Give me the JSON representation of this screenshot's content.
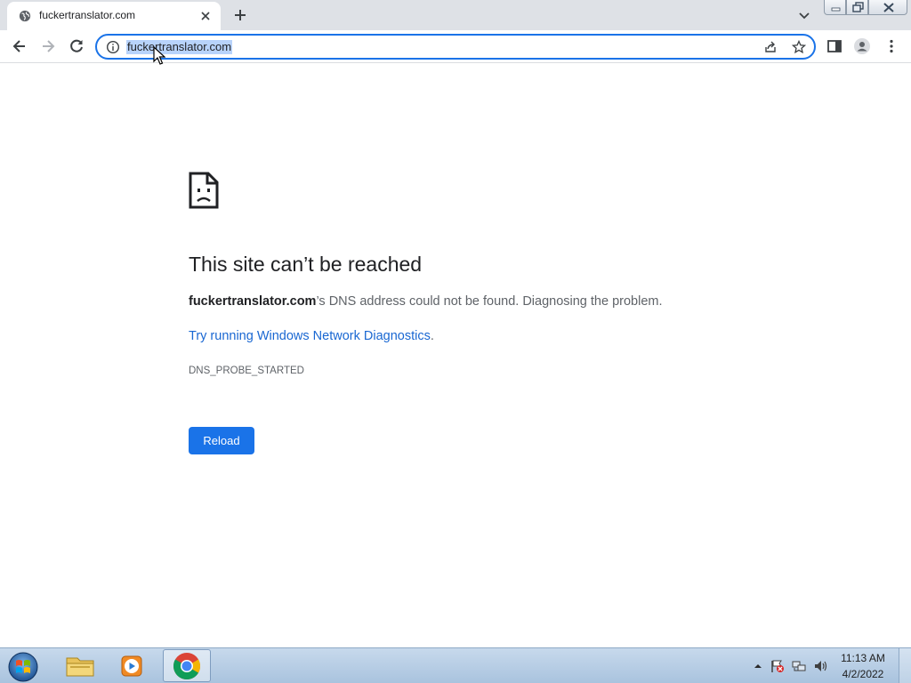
{
  "browser": {
    "tab": {
      "title": "fuckertranslator.com",
      "favicon": "globe-icon"
    },
    "omnibox": {
      "url": "fuckertranslator.com",
      "site_info_icon": "info-icon"
    },
    "toolbar_icons": [
      "back-icon",
      "forward-icon",
      "reload-icon",
      "share-icon",
      "star-icon",
      "side-panel-icon",
      "profile-icon",
      "menu-icon"
    ]
  },
  "error_page": {
    "icon": "sad-document-icon",
    "title": "This site can’t be reached",
    "domain": "fuckertranslator.com",
    "description_rest": "’s DNS address could not be found. Diagnosing the problem.",
    "link_text": "Try running Windows Network Diagnostics",
    "link_suffix": ".",
    "error_code": "DNS_PROBE_STARTED",
    "reload_label": "Reload"
  },
  "taskbar": {
    "clock_time": "11:13 AM",
    "clock_date": "4/2/2022",
    "apps": [
      "file-explorer-icon",
      "media-player-icon",
      "chrome-icon"
    ],
    "tray_icons": [
      "show-hidden-icons-icon",
      "action-center-flag-icon",
      "network-icon",
      "volume-icon"
    ]
  },
  "colors": {
    "accent": "#1a73e8",
    "link": "#1967d2",
    "tabstrip": "#dee1e6",
    "url_selection": "#b8d3fb"
  }
}
